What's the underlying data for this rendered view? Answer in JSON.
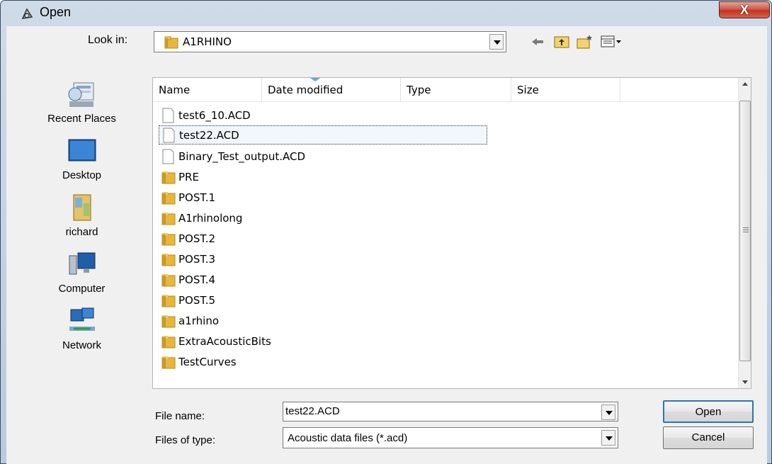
{
  "window": {
    "title": "Open",
    "close_label": "X"
  },
  "lookin": {
    "label": "Look in:",
    "value": "A1RHINO"
  },
  "toolbar": {
    "icons": [
      "back-icon",
      "up-folder-icon",
      "new-folder-icon",
      "view-menu-icon"
    ]
  },
  "places": [
    {
      "label": "Recent Places",
      "icon": "recent-places-icon"
    },
    {
      "label": "Desktop",
      "icon": "desktop-icon"
    },
    {
      "label": "richard",
      "icon": "user-folder-icon"
    },
    {
      "label": "Computer",
      "icon": "computer-icon"
    },
    {
      "label": "Network",
      "icon": "network-icon"
    }
  ],
  "columns": [
    "Name",
    "Date modified",
    "Type",
    "Size"
  ],
  "files": [
    {
      "name": "test6_10.ACD",
      "kind": "file"
    },
    {
      "name": "test22.ACD",
      "kind": "file",
      "selected": true
    },
    {
      "name": "Binary_Test_output.ACD",
      "kind": "file"
    },
    {
      "name": "PRE",
      "kind": "folder"
    },
    {
      "name": "POST.1",
      "kind": "folder"
    },
    {
      "name": "A1rhinolong",
      "kind": "folder"
    },
    {
      "name": "POST.2",
      "kind": "folder"
    },
    {
      "name": "POST.3",
      "kind": "folder"
    },
    {
      "name": "POST.4",
      "kind": "folder"
    },
    {
      "name": "POST.5",
      "kind": "folder"
    },
    {
      "name": "a1rhino",
      "kind": "folder"
    },
    {
      "name": "ExtraAcousticBits",
      "kind": "folder"
    },
    {
      "name": "TestCurves",
      "kind": "folder"
    }
  ],
  "file_name": {
    "label": "File name:",
    "value": "test22.ACD"
  },
  "file_type": {
    "label": "Files of type:",
    "value": "Acoustic data files (*.acd)"
  },
  "buttons": {
    "open": "Open",
    "cancel": "Cancel"
  },
  "colors": {
    "selection": "#f2f7fd",
    "close_button": "#c2321f",
    "default_button_border": "#2b75b8"
  }
}
